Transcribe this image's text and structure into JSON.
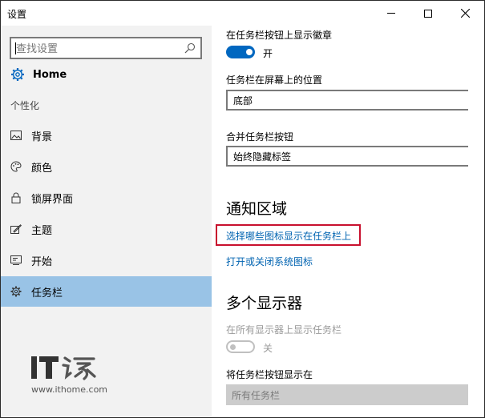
{
  "window": {
    "title": "设置"
  },
  "sidebar": {
    "search_placeholder": "查找设置",
    "home_label": "Home",
    "section_label": "个性化",
    "items": [
      {
        "label": "背景",
        "icon": "picture-icon"
      },
      {
        "label": "颜色",
        "icon": "palette-icon"
      },
      {
        "label": "锁屏界面",
        "icon": "lock-icon"
      },
      {
        "label": "主题",
        "icon": "brush-icon"
      },
      {
        "label": "开始",
        "icon": "start-icon"
      },
      {
        "label": "任务栏",
        "icon": "taskbar-icon",
        "selected": true
      }
    ],
    "watermark_brand": "IT之家",
    "watermark_url": "www.ithome.com"
  },
  "content": {
    "badge_label": "在任务栏按钮上显示徽章",
    "badge_toggle_state": "开",
    "position_label": "任务栏在屏幕上的位置",
    "position_value": "底部",
    "combine_label": "合并任务栏按钮",
    "combine_value": "始终隐藏标签",
    "notification_heading": "通知区域",
    "link_select_icons": "选择哪些图标显示在任务栏上",
    "link_system_icons": "打开或关闭系统图标",
    "multi_display_heading": "多个显示器",
    "show_all_label": "在所有显示器上显示任务栏",
    "show_all_toggle_state": "关",
    "show_buttons_label": "将任务栏按钮显示在",
    "show_buttons_value": "所有任务栏"
  },
  "colors": {
    "accent": "#0067c0",
    "selected_nav": "#99c3e6",
    "highlight": "#c8102e",
    "link": "#0063b1"
  }
}
